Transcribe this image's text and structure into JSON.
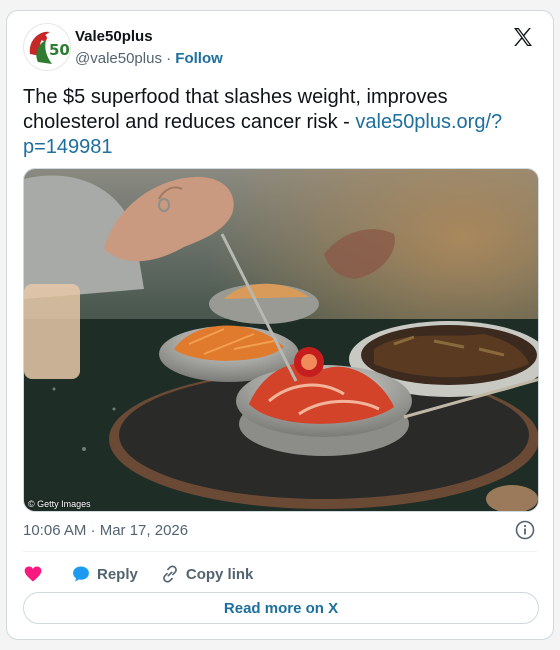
{
  "author": {
    "name": "Vale50plus",
    "handle": "@vale50plus",
    "separator": "·",
    "follow_label": "Follow",
    "avatar_text": "50"
  },
  "platform_icon": "x-logo-icon",
  "tweet": {
    "text": "The $5 superfood that slashes weight, improves cholesterol and reduces cancer risk - ",
    "link": "vale50plus.org/?p=149981"
  },
  "media": {
    "credit": "© Getty Images",
    "alt_description_icon": "photo"
  },
  "meta": {
    "timestamp": "10:06 AM · Mar 17, 2026",
    "info_icon": "info-icon"
  },
  "actions": {
    "like_label": "",
    "reply_label": "Reply",
    "copy_label": "Copy link"
  },
  "read_more_label": "Read more on X",
  "colors": {
    "link": "#1d6f9e",
    "heart": "#f91880",
    "reply_bubble": "#1d9bf0",
    "muted": "#536471"
  }
}
